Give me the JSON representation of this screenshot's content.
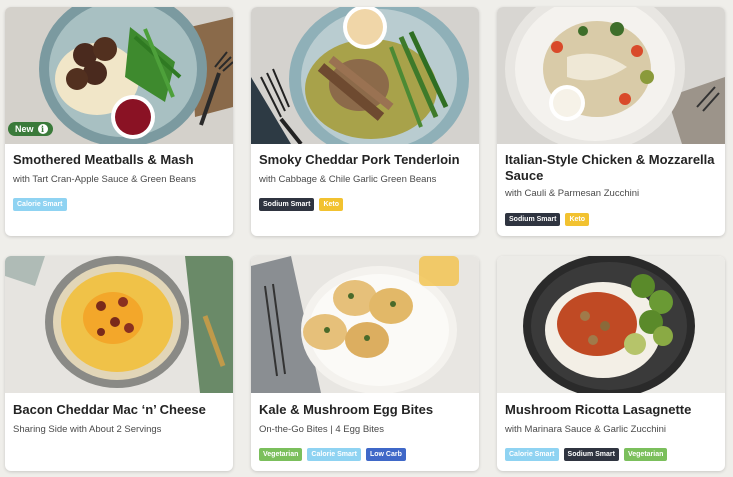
{
  "colors": {
    "background": "#efeeea",
    "new_badge": "#3a7a3a",
    "tag_calorie_smart": "#8fd3f2",
    "tag_sodium_smart": "#2f3440",
    "tag_keto": "#f2c230",
    "tag_vegetarian": "#7bbf5c",
    "tag_low_carb": "#3f68c8"
  },
  "cards": [
    {
      "title": "Smothered Meatballs & Mash",
      "subtitle": "with Tart Cran-Apple Sauce & Green Beans",
      "badge": "New",
      "badge_icon": "info-icon",
      "tags": [
        "Calorie Smart"
      ]
    },
    {
      "title": "Smoky Cheddar Pork Tenderloin",
      "subtitle": "with Cabbage & Chile Garlic Green Beans",
      "tags": [
        "Sodium Smart",
        "Keto"
      ]
    },
    {
      "title": "Italian-Style Chicken & Mozzarella Sauce",
      "subtitle": "with Cauli & Parmesan Zucchini",
      "tags": [
        "Sodium Smart",
        "Keto"
      ]
    },
    {
      "title": "Bacon Cheddar Mac ‘n’ Cheese",
      "subtitle": "Sharing Side with About 2 Servings",
      "tags": []
    },
    {
      "title": "Kale & Mushroom Egg Bites",
      "subtitle": "On-the-Go Bites | 4 Egg Bites",
      "tags": [
        "Vegetarian",
        "Calorie Smart",
        "Low Carb"
      ]
    },
    {
      "title": "Mushroom Ricotta Lasagnette",
      "subtitle": "with Marinara Sauce & Garlic Zucchini",
      "tags": [
        "Calorie Smart",
        "Sodium Smart",
        "Vegetarian"
      ]
    }
  ]
}
